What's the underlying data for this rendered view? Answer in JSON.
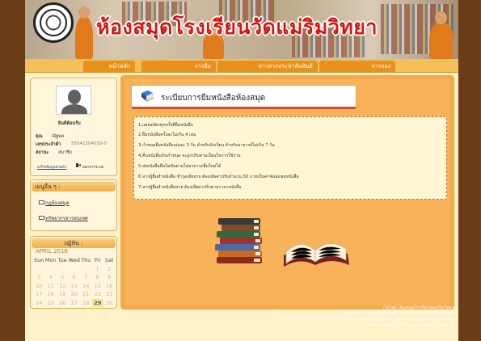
{
  "header": {
    "title": "ห้องสมุดโรงเรียนวัดแม่ริมวิทยา"
  },
  "nav": {
    "items": [
      {
        "label": "หน้าหลัก"
      },
      {
        "label": "การยืม"
      },
      {
        "label": "ข่าวสารประชาสัมพันธ์"
      },
      {
        "label": "การจอง"
      }
    ]
  },
  "profile": {
    "welcome": "ยินดีต้อนรับ",
    "name_label": "คุณ",
    "name_value": "ณัฐพล",
    "id_label": "เลขประจำตัว",
    "id_value": "55541204010-0",
    "status_label": "สถานะ",
    "status_value": "สมาชิก",
    "edit_link": "แก้ไขข้อมูลส่วนตัว",
    "logout_link": "ออกจากระบบ"
  },
  "menu": {
    "title": "เมนูอื่น ๆ :",
    "items": [
      {
        "label": "กฎห้องสมุด"
      },
      {
        "label": "ทรัพยากรสารสนเทศ"
      }
    ]
  },
  "calendar": {
    "title": "ปฏิทิน :",
    "month": "APRIL 2016",
    "weekdays": [
      "Sun",
      "Mon",
      "Tue",
      "Wed",
      "Thu",
      "Fri",
      "Sat"
    ],
    "weeks": [
      [
        "",
        "",
        "",
        "",
        "",
        "1",
        "2"
      ],
      [
        "3",
        "4",
        "5",
        "6",
        "7",
        "8",
        "9"
      ],
      [
        "10",
        "11",
        "12",
        "13",
        "14",
        "15",
        "16"
      ],
      [
        "17",
        "18",
        "19",
        "20",
        "21",
        "22",
        "23"
      ],
      [
        "24",
        "25",
        "26",
        "27",
        "28",
        "29",
        "30"
      ]
    ],
    "today": "29"
  },
  "main": {
    "heading": "ระเบียบการยืมหนังสือห้องสมุด",
    "rules": [
      "1.แสดงบัตรทุกครั้งที่ยืมหนังสือ",
      "2.ยืมหนังสือครั้งละไม่เกิน 4 เล่ม",
      "3.กำหนดยืมหนังสือเล่มละ 3 วัน สำหรับนักเรียน สำหรับอาจารย์ไม่เกิน 7 วัน",
      "4.คืนหนังสือเกินกำหนด จะถูกปรับตามเงื่อนไขการใช้งาน",
      "5.ส่งหนังสือคืนไม่ทันตามไม่สามารถยืมใหม่ได้",
      "6.หากผู้ยืมทำหนังสือ ชำรุดเสียหาย ต้องเสียค่าปรับจำนวน 50 บาทเป็นค่าซ่อมแซมหนังสือ",
      "7.หากผู้ยืมทำหนังสือหาย ต้องเสียค่าปรับตามราคาหนังสือ"
    ]
  },
  "footer": {
    "lines": [
      "เว็บไซต์: ห้องสมุดโรงเรียนวัดแม่ริมวิทยา",
      "พัฒนาโดย: นายณัฐพล วิไลวัลย์ รหัสนักศึกษา 55541204010-0",
      "นักศึกษาชั้นปีที่ 4 สาขาวิชาเทคโนโลยีสารสนเทศทางคอมพิวเตอร์ คณะบริหารธุรกิจและศิลปศาสตร์",
      "มหาวิทยาลัยเทคโนโลยีราชมงคลล้านนา เชียงใหม่"
    ]
  },
  "colors": {
    "page_bg": "#6b3d17",
    "content_bg": "#f6a94a",
    "title_red": "#d8140f",
    "nav_tab": "#e8921e"
  }
}
